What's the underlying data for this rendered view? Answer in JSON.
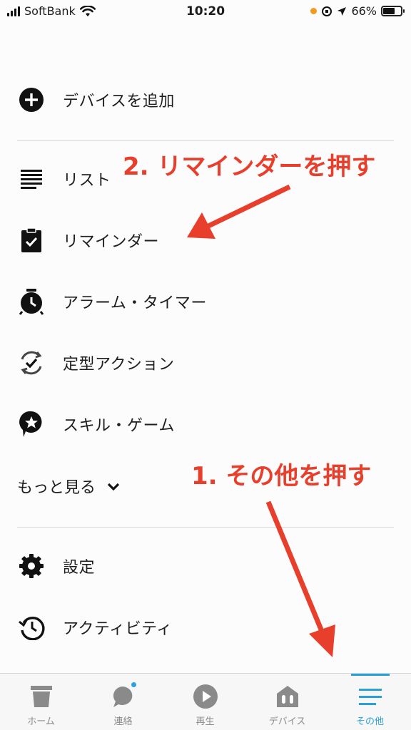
{
  "status_bar": {
    "carrier": "SoftBank",
    "time": "10:20",
    "battery": "66%",
    "battery_level": 0.66
  },
  "menu": {
    "add_device": "デバイスを追加",
    "list": "リスト",
    "reminder": "リマインダー",
    "alarm_timer": "アラーム・タイマー",
    "routine": "定型アクション",
    "skills_games": "スキル・ゲーム",
    "see_more": "もっと見る",
    "settings": "設定",
    "activity": "アクティビティ"
  },
  "annotations": {
    "step1": "1. その他を押す",
    "step2": "2. リマインダーを押す",
    "color": "#e83e2c"
  },
  "tab_bar": {
    "home": "ホーム",
    "communicate": "連絡",
    "play": "再生",
    "devices": "デバイス",
    "more": "その他",
    "active_color": "#2aa0d8"
  },
  "icons": [
    "plus-circle-icon",
    "list-icon",
    "reminder-clipboard-icon",
    "alarm-clock-icon",
    "routine-check-icon",
    "skill-star-icon",
    "chevron-down-icon",
    "gear-icon",
    "history-icon",
    "home-icon",
    "chat-bubble-icon",
    "play-icon",
    "devices-icon",
    "menu-icon",
    "wifi-icon",
    "location-arrow-icon",
    "lock-rotation-icon"
  ]
}
